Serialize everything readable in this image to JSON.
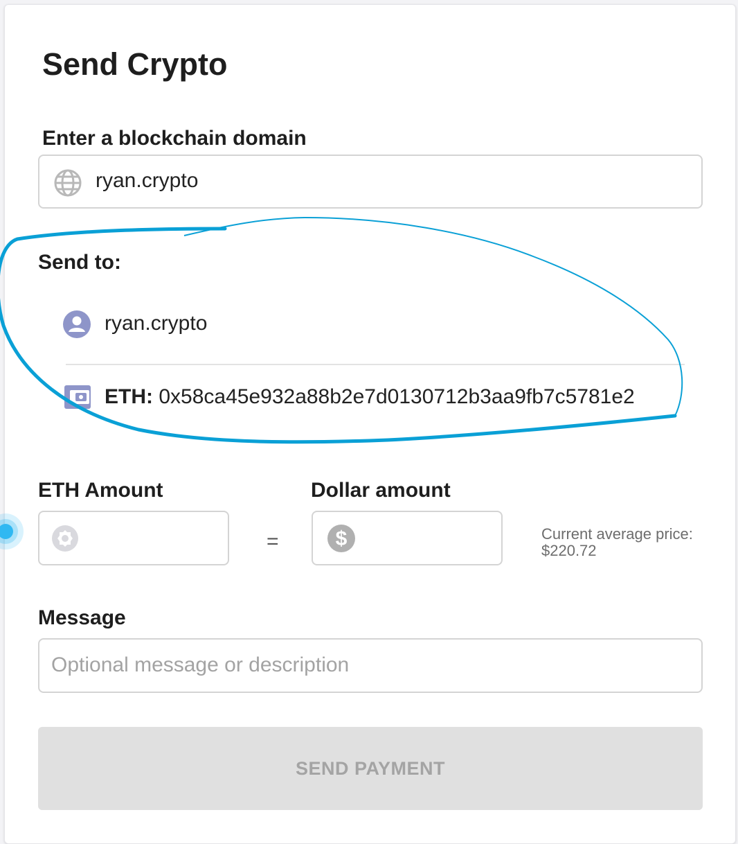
{
  "page_title": "Send Crypto",
  "domain_section": {
    "label": "Enter a blockchain domain",
    "value": "ryan.crypto",
    "icon": "globe-icon"
  },
  "send_to": {
    "label": "Send to:",
    "recipient_name": "ryan.crypto",
    "recipient_icon": "user-avatar-icon",
    "address_currency": "ETH:",
    "address": "0x58ca45e932a88b2e7d0130712b3aa9fb7c5781e2",
    "address_icon": "wallet-icon"
  },
  "amounts": {
    "eth_label": "ETH Amount",
    "eth_value": "",
    "eth_icon": "eth-coin-icon",
    "equals": "=",
    "dollar_label": "Dollar amount",
    "dollar_value": "",
    "dollar_icon": "dollar-coin-icon",
    "price_label": "Current average price:",
    "price_value": "$220.72"
  },
  "message": {
    "label": "Message",
    "placeholder": "Optional message or description",
    "value": ""
  },
  "submit": {
    "label": "SEND PAYMENT",
    "enabled": false
  },
  "colors": {
    "annotation_stroke": "#0aa0d6",
    "avatar_purple": "#8e95c9",
    "disabled_button_bg": "#e0e0e0",
    "disabled_button_text": "#a4a4a4",
    "cursor_blue": "#2fb8f2"
  }
}
